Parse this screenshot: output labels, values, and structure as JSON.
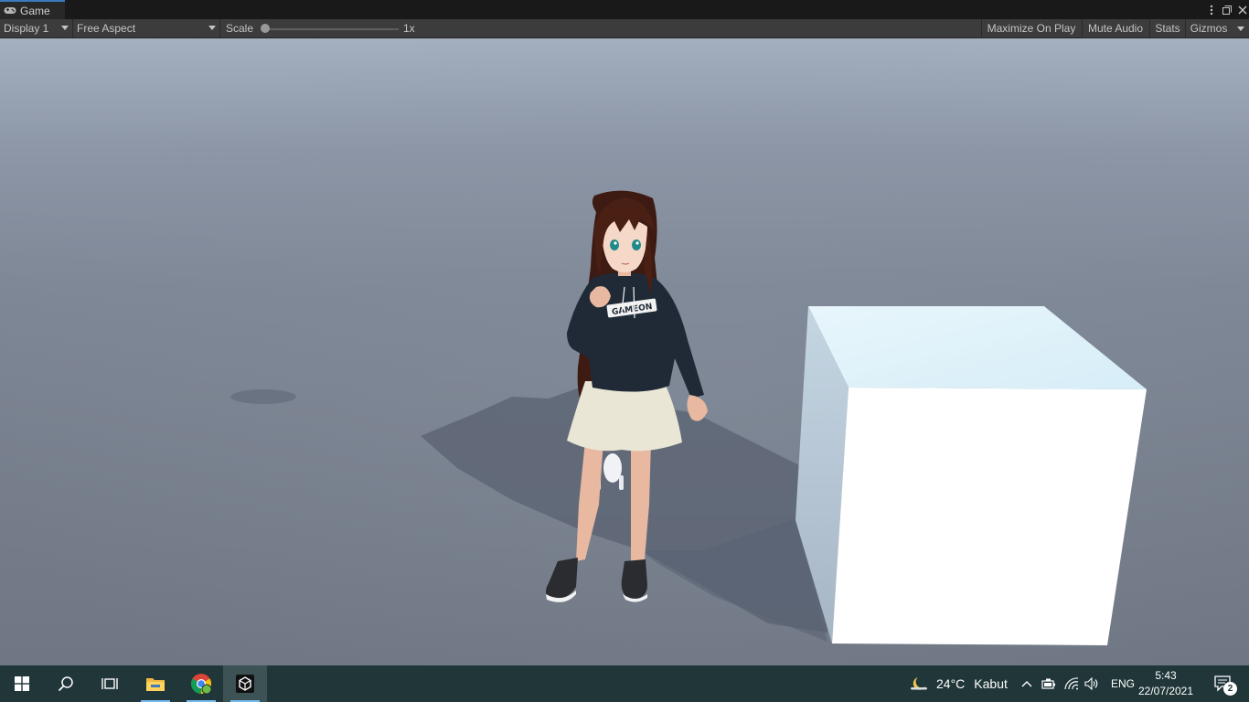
{
  "window": {
    "tab_title": "Game",
    "icons": [
      "game-controller-icon",
      "more-vert-icon",
      "restore-icon",
      "close-icon"
    ]
  },
  "toolbar": {
    "display_label": "Display 1",
    "aspect_label": "Free Aspect",
    "scale_label": "Scale",
    "scale_value": "1x",
    "scale_fraction": 0.0,
    "maximize_label": "Maximize On Play",
    "mute_label": "Mute Audio",
    "stats_label": "Stats",
    "gizmos_label": "Gizmos"
  },
  "scene": {
    "hoodie_text": "GAMEON"
  },
  "taskbar": {
    "icons": [
      "windows-start-icon",
      "search-icon",
      "task-view-icon",
      "file-explorer-icon",
      "chrome-icon",
      "unity-icon"
    ],
    "weather": {
      "temperature": "24°C",
      "condition": "Kabut",
      "icon": "night-weather-icon"
    },
    "language": "ENG",
    "time": "5:43",
    "date": "22/07/2021",
    "notification_count": "2"
  },
  "colors": {
    "tab_accent": "#3a79bb",
    "taskbar_bg": "#203639",
    "taskbar_indicator": "#76b9ed"
  }
}
